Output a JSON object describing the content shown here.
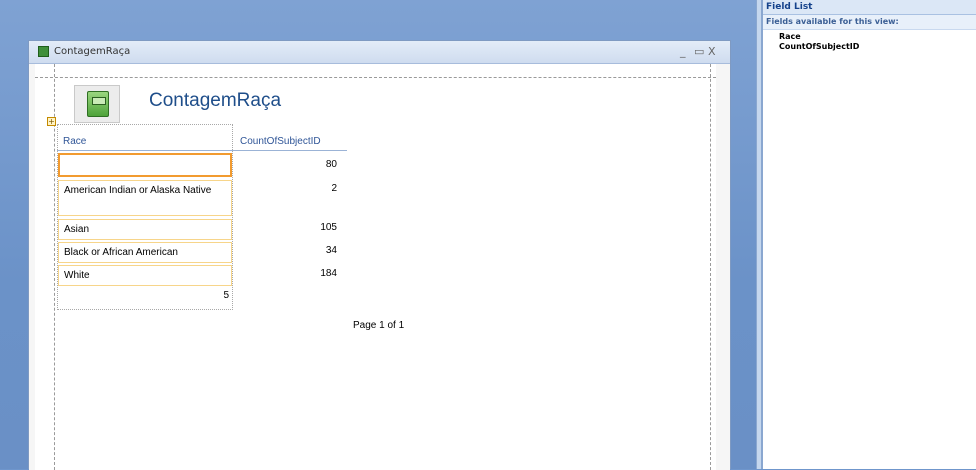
{
  "window": {
    "title": "ContagemRaça",
    "controls": {
      "minimize": "_",
      "maximize": "▭",
      "close": "X"
    }
  },
  "report": {
    "title": "ContagemRaça",
    "columns": {
      "race": "Race",
      "count": "CountOfSubjectID"
    },
    "rows": [
      {
        "race": "",
        "count": "80"
      },
      {
        "race": "American Indian or Alaska Native",
        "count": "2"
      },
      {
        "race": "Asian",
        "count": "105"
      },
      {
        "race": "Black or African American",
        "count": "34"
      },
      {
        "race": "White",
        "count": "184"
      }
    ],
    "total": "5",
    "footer": "Page 1 of 1"
  },
  "field_list": {
    "title": "Field List",
    "subtitle": "Fields available for this view:",
    "fields": [
      "Race",
      "CountOfSubjectID"
    ]
  },
  "colors": {
    "workspace": "#6f96cc",
    "title_blue": "#1f4e8a",
    "selection_orange": "#f29b30"
  }
}
